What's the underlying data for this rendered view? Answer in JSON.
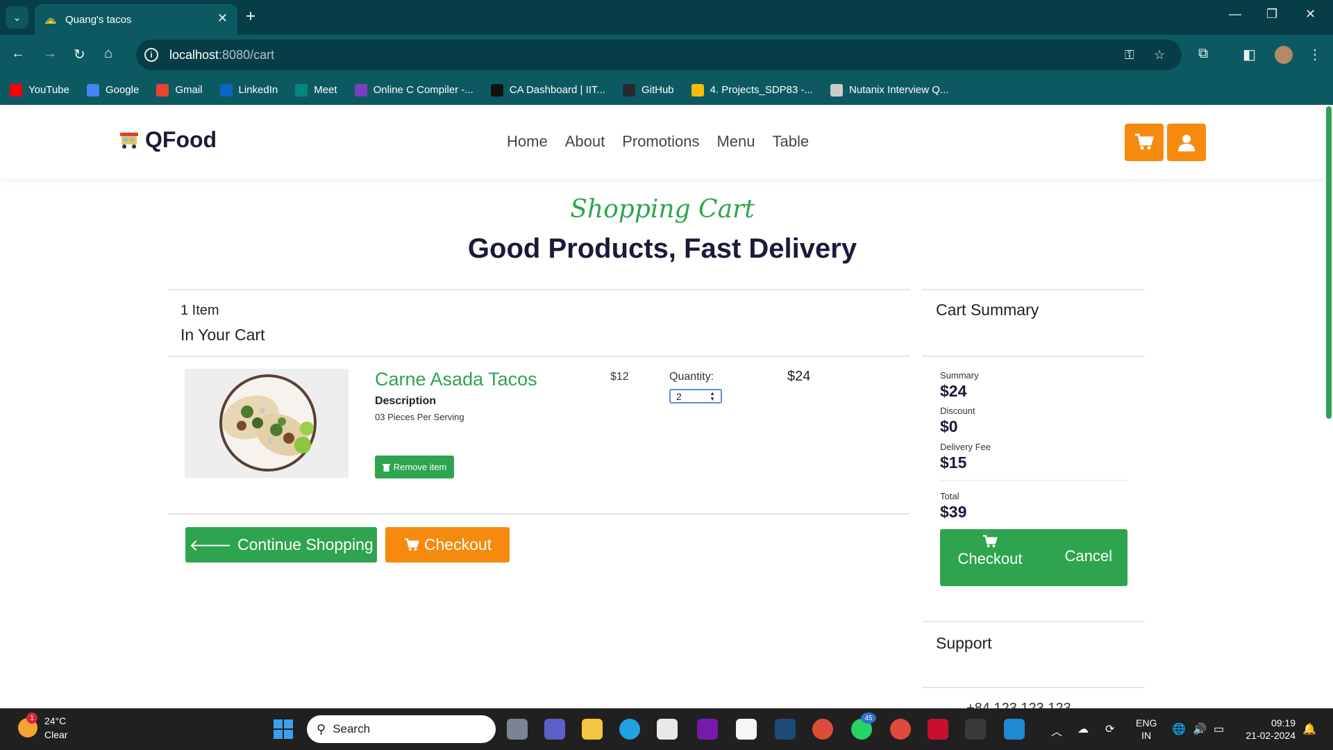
{
  "browser": {
    "tab_title": "Quang's tacos",
    "url_host": "localhost",
    "url_path": ":8080/cart",
    "bookmarks": [
      {
        "label": "YouTube",
        "icon": "youtube-icon",
        "color": "#ff0000"
      },
      {
        "label": "Google",
        "icon": "google-icon",
        "color": "#4285f4"
      },
      {
        "label": "Gmail",
        "icon": "gmail-icon",
        "color": "#ea4335"
      },
      {
        "label": "LinkedIn",
        "icon": "linkedin-icon",
        "color": "#0a66c2"
      },
      {
        "label": "Meet",
        "icon": "meet-icon",
        "color": "#00897b"
      },
      {
        "label": "Online C Compiler -...",
        "icon": "compiler-icon",
        "color": "#7b3fbf"
      },
      {
        "label": "CA Dashboard | IIT...",
        "icon": "dashboard-icon",
        "color": "#111111"
      },
      {
        "label": "GitHub",
        "icon": "github-icon",
        "color": "#24292e"
      },
      {
        "label": "4. Projects_SDP83 -...",
        "icon": "drive-icon",
        "color": "#fbbc04"
      },
      {
        "label": "Nutanix Interview Q...",
        "icon": "nutanix-icon",
        "color": "#cccccc"
      }
    ]
  },
  "site": {
    "logo": "QFood",
    "nav": [
      "Home",
      "About",
      "Promotions",
      "Menu",
      "Table"
    ],
    "accent_orange": "#f68a0e",
    "accent_green": "#2ea44f"
  },
  "cart": {
    "subtitle": "Shopping Cart",
    "title": "Good Products, Fast Delivery",
    "item_count": "1 Item",
    "in_your_cart": "In Your Cart",
    "item": {
      "name": "Carne Asada Tacos",
      "description_label": "Description",
      "description": "03 Pieces Per Serving",
      "remove_label": "Remove item",
      "unit_price": "$12",
      "quantity_label": "Quantity:",
      "quantity": "2",
      "line_total": "$24"
    },
    "continue_label": "Continue Shopping",
    "checkout_label": "Checkout"
  },
  "summary": {
    "title": "Cart Summary",
    "summary_label": "Summary",
    "summary_value": "$24",
    "discount_label": "Discount",
    "discount_value": "$0",
    "delivery_label": "Delivery Fee",
    "delivery_value": "$15",
    "total_label": "Total",
    "total_value": "$39",
    "checkout_label": "Checkout",
    "cancel_label": "Cancel",
    "support_title": "Support",
    "phone": "+84 123 123 123"
  },
  "taskbar": {
    "temperature": "24°C",
    "condition": "Clear",
    "weather_badge": "1",
    "search_placeholder": "Search",
    "whatsapp_badge": "45",
    "lang_line1": "ENG",
    "lang_line2": "IN",
    "time": "09:19",
    "date": "21-02-2024"
  }
}
